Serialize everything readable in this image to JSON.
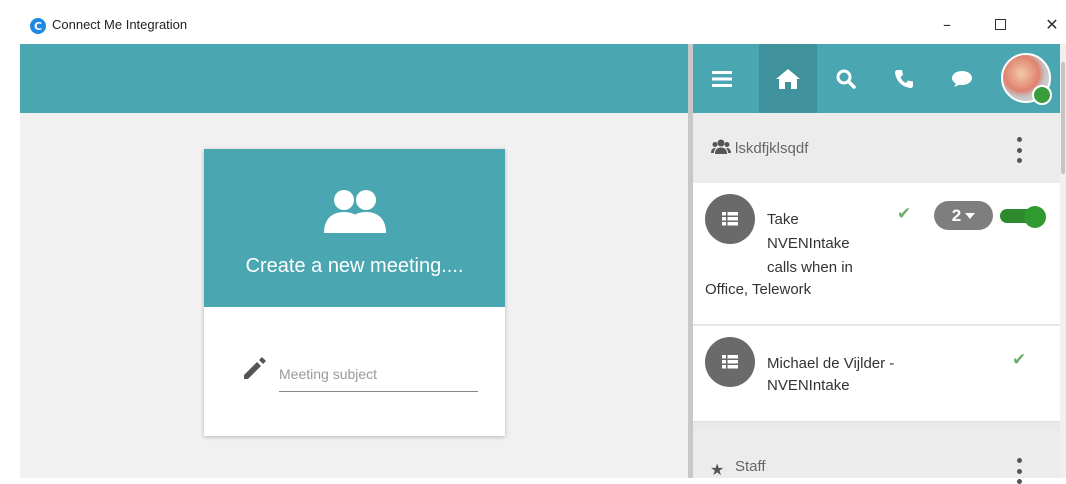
{
  "window": {
    "title": "Connect Me Integration",
    "app_icon_letter": "C",
    "minimize_label": "–",
    "close_label": "✕"
  },
  "meeting_card": {
    "title": "Create a new meeting....",
    "subject_placeholder": "Meeting subject",
    "subject_value": ""
  },
  "nav": {
    "items": [
      {
        "icon": "menu-icon"
      },
      {
        "icon": "home-icon",
        "active": true
      },
      {
        "icon": "search-icon"
      },
      {
        "icon": "phone-icon"
      },
      {
        "icon": "chat-icon"
      }
    ],
    "avatar_status": "online",
    "status_color": "#3a9c3a"
  },
  "groups": [
    {
      "name": "lskdfjklsqdf",
      "icon": "group-icon",
      "items": [
        {
          "lines": [
            "Take",
            "NVENIntake",
            "calls when in",
            "Office, Telework"
          ],
          "checked": true,
          "badge": "2",
          "toggle_on": true
        },
        {
          "lines": [
            "Michael de Vijlder -",
            "NVENIntake"
          ],
          "checked": true
        }
      ]
    },
    {
      "name": "Staff",
      "icon": "star-icon"
    }
  ],
  "colors": {
    "accent": "#4aa6b1",
    "accent_active": "#3f929c",
    "toggle_on": "#2f9a2f",
    "check": "#6fae6f"
  }
}
